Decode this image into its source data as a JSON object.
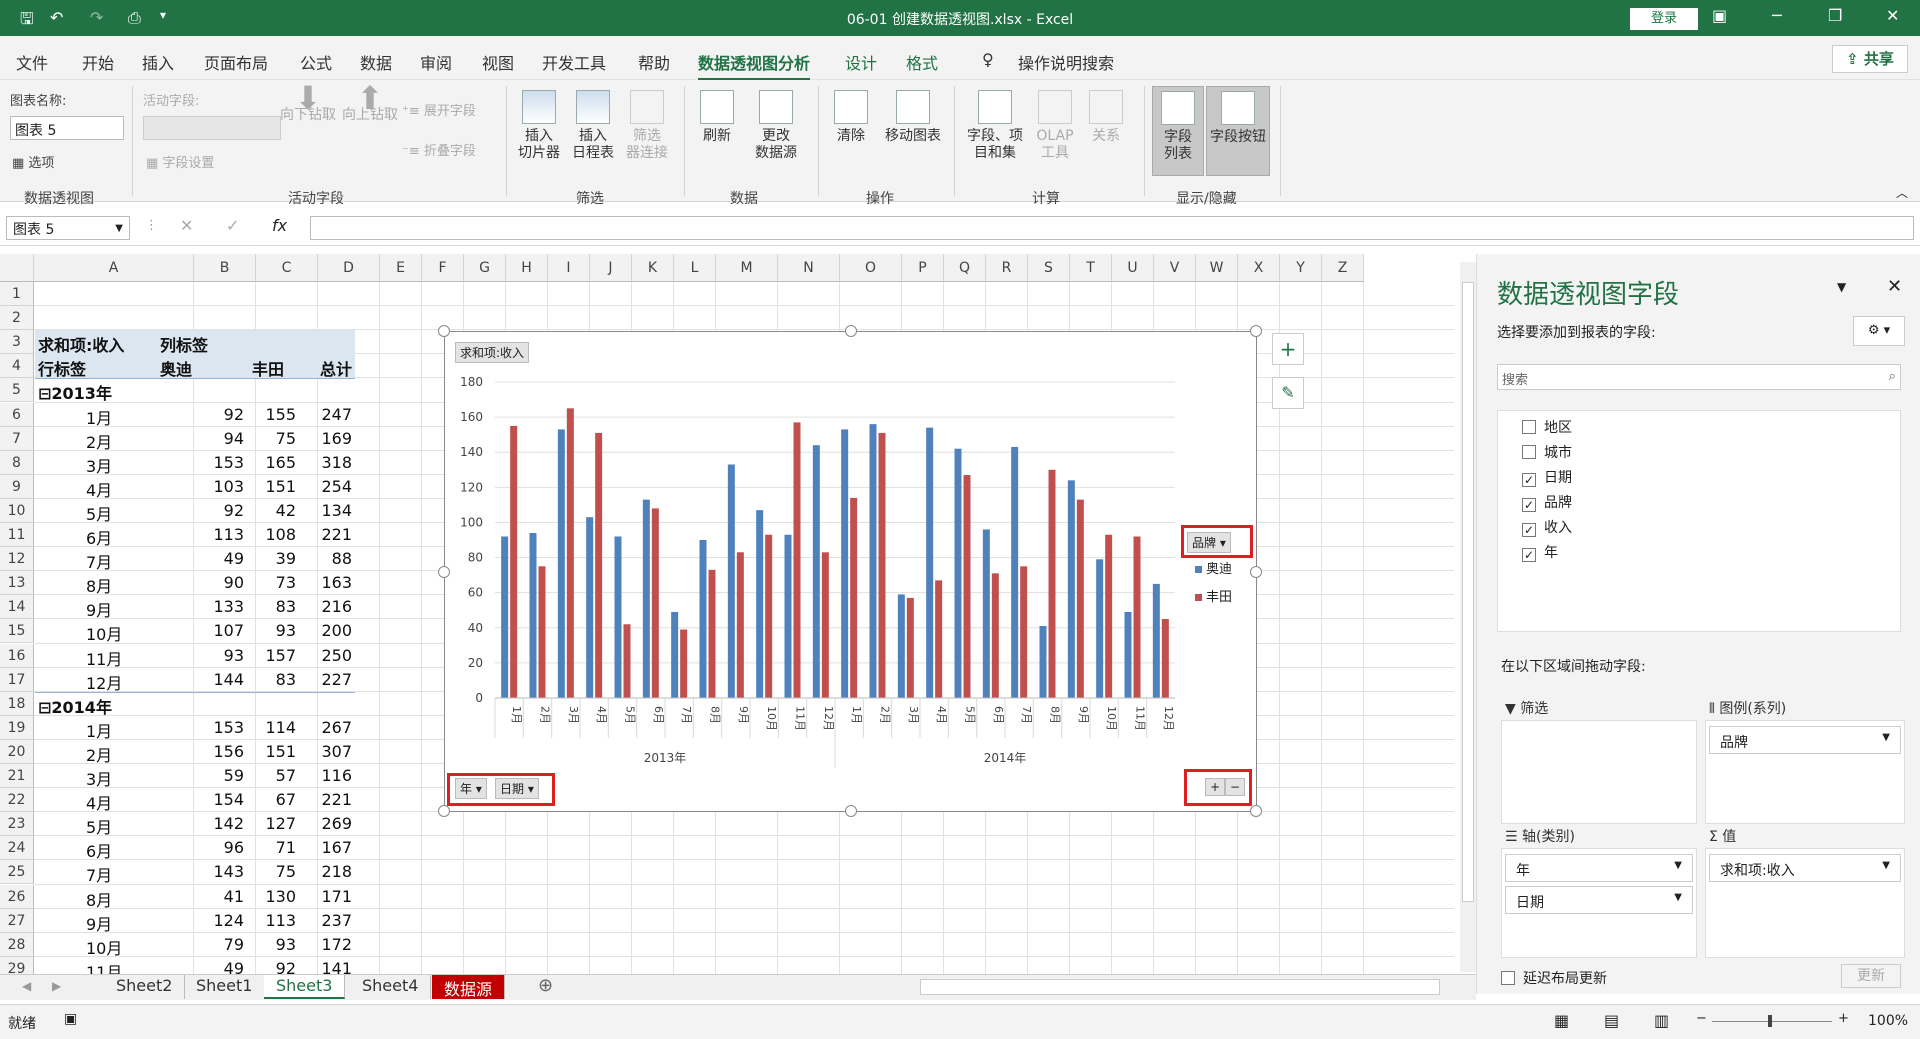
{
  "titlebar": {
    "title": "06-01 创建数据透视图.xlsx  -  Excel",
    "login": "登录"
  },
  "menu": {
    "items": [
      "文件",
      "开始",
      "插入",
      "页面布局",
      "公式",
      "数据",
      "审阅",
      "视图",
      "开发工具",
      "帮助"
    ],
    "context": [
      "数据透视图分析",
      "设计",
      "格式"
    ],
    "search": "操作说明搜索",
    "share": "共享"
  },
  "ribbon": {
    "chart_name_label": "图表名称:",
    "chart_name_value": "图表 5",
    "options": "选项",
    "group1": "数据透视图",
    "active_field_label": "活动字段:",
    "field_settings": "字段设置",
    "drill_down": "向下钻取",
    "drill_up": "向上钻取",
    "expand": "展开字段",
    "collapse": "折叠字段",
    "group2": "活动字段",
    "insert_slicer": "插入\n切片器",
    "insert_timeline": "插入\n日程表",
    "filter_conn": "筛选\n器连接",
    "group3": "筛选",
    "refresh": "刷新",
    "change_source": "更改\n数据源",
    "group4": "数据",
    "clear": "清除",
    "move_chart": "移动图表",
    "group5": "操作",
    "fields_items": "字段、项\n目和集",
    "olap": "OLAP\n工具",
    "relations": "关系",
    "group6": "计算",
    "field_list": "字段\n列表",
    "field_buttons": "字段按钮",
    "group7": "显示/隐藏"
  },
  "formula": {
    "namebox": "图表 5",
    "fx": "fx"
  },
  "columns": [
    "A",
    "B",
    "C",
    "D",
    "E",
    "F",
    "G",
    "H",
    "I",
    "J",
    "K",
    "L",
    "M",
    "N",
    "O",
    "P",
    "Q",
    "R",
    "S",
    "T",
    "U",
    "V",
    "W",
    "X",
    "Y",
    "Z"
  ],
  "rows": [
    "1",
    "2",
    "3",
    "4",
    "5",
    "6",
    "7",
    "8",
    "9",
    "10",
    "11",
    "12",
    "13",
    "14",
    "15",
    "16",
    "17",
    "18",
    "19",
    "20",
    "21",
    "22",
    "23",
    "24",
    "25",
    "26",
    "27",
    "28",
    "29"
  ],
  "pivot": {
    "sum_label": "求和项:收入",
    "col_label": "列标签",
    "row_label": "行标签",
    "h1": "奥迪",
    "h2": "丰田",
    "h3": "总计",
    "y2013": "⊟2013年",
    "y2014": "⊟2014年",
    "rows2013": [
      [
        "1月",
        "92",
        "155",
        "247"
      ],
      [
        "2月",
        "94",
        "75",
        "169"
      ],
      [
        "3月",
        "153",
        "165",
        "318"
      ],
      [
        "4月",
        "103",
        "151",
        "254"
      ],
      [
        "5月",
        "92",
        "42",
        "134"
      ],
      [
        "6月",
        "113",
        "108",
        "221"
      ],
      [
        "7月",
        "49",
        "39",
        "88"
      ],
      [
        "8月",
        "90",
        "73",
        "163"
      ],
      [
        "9月",
        "133",
        "83",
        "216"
      ],
      [
        "10月",
        "107",
        "93",
        "200"
      ],
      [
        "11月",
        "93",
        "157",
        "250"
      ],
      [
        "12月",
        "144",
        "83",
        "227"
      ]
    ],
    "rows2014": [
      [
        "1月",
        "153",
        "114",
        "267"
      ],
      [
        "2月",
        "156",
        "151",
        "307"
      ],
      [
        "3月",
        "59",
        "57",
        "116"
      ],
      [
        "4月",
        "154",
        "67",
        "221"
      ],
      [
        "5月",
        "142",
        "127",
        "269"
      ],
      [
        "6月",
        "96",
        "71",
        "167"
      ],
      [
        "7月",
        "143",
        "75",
        "218"
      ],
      [
        "8月",
        "41",
        "130",
        "171"
      ],
      [
        "9月",
        "124",
        "113",
        "237"
      ],
      [
        "10月",
        "79",
        "93",
        "172"
      ],
      [
        "11月",
        "49",
        "92",
        "141"
      ]
    ]
  },
  "chart_data": {
    "type": "bar",
    "title": "求和项:收入",
    "ylim": [
      0,
      180
    ],
    "yticks": [
      "180",
      "160",
      "140",
      "120",
      "100",
      "80",
      "60",
      "40",
      "20",
      "0"
    ],
    "categories": [
      "1月",
      "2月",
      "3月",
      "4月",
      "5月",
      "6月",
      "7月",
      "8月",
      "9月",
      "10月",
      "11月",
      "12月",
      "1月",
      "2月",
      "3月",
      "4月",
      "5月",
      "6月",
      "7月",
      "8月",
      "9月",
      "10月",
      "11月",
      "12月"
    ],
    "groups": [
      "2013年",
      "2014年"
    ],
    "series": [
      {
        "name": "奥迪",
        "color": "#4f81bd",
        "values": [
          92,
          94,
          153,
          103,
          92,
          113,
          49,
          90,
          133,
          107,
          93,
          144,
          153,
          156,
          59,
          154,
          142,
          96,
          143,
          41,
          124,
          79,
          49,
          65
        ]
      },
      {
        "name": "丰田",
        "color": "#c0504d",
        "values": [
          155,
          75,
          165,
          151,
          42,
          108,
          39,
          73,
          83,
          93,
          157,
          83,
          114,
          151,
          57,
          67,
          127,
          71,
          75,
          130,
          113,
          93,
          92,
          45
        ]
      }
    ],
    "legend_field": "品牌",
    "axis_fields": [
      "年",
      "日期"
    ],
    "value_button": "求和项:收入"
  },
  "pane": {
    "title": "数据透视图字段",
    "subtitle": "选择要添加到报表的字段:",
    "search": "搜索",
    "fields": [
      {
        "name": "地区",
        "checked": false
      },
      {
        "name": "城市",
        "checked": false
      },
      {
        "name": "日期",
        "checked": true
      },
      {
        "name": "品牌",
        "checked": true
      },
      {
        "name": "收入",
        "checked": true
      },
      {
        "name": "年",
        "checked": true
      }
    ],
    "drag_label": "在以下区域间拖动字段:",
    "filter": "筛选",
    "legend": "图例(系列)",
    "axis": "轴(类别)",
    "values": "值",
    "legend_item": "品牌",
    "axis_item1": "年",
    "axis_item2": "日期",
    "value_item": "求和项:收入",
    "defer": "延迟布局更新",
    "update": "更新"
  },
  "sheets": [
    "Sheet2",
    "Sheet1",
    "Sheet3",
    "Sheet4",
    "数据源"
  ],
  "status": {
    "ready": "就绪",
    "zoom": "100%"
  }
}
